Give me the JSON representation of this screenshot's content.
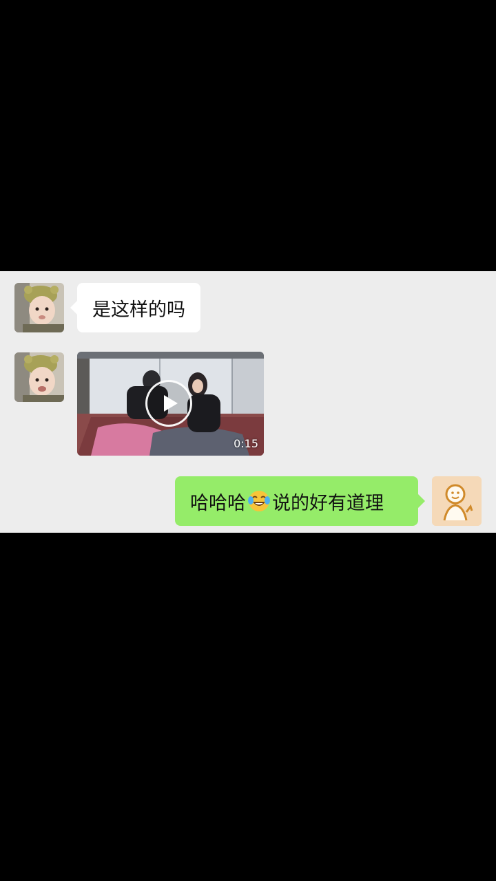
{
  "chat": {
    "messages": [
      {
        "side": "left",
        "type": "text",
        "text": "是这样的吗"
      },
      {
        "side": "left",
        "type": "video",
        "duration": "0:15"
      },
      {
        "side": "right",
        "type": "text",
        "text_before": "哈哈哈",
        "emoji": "tears-of-joy-emoji",
        "text_after": "说的好有道理"
      }
    ]
  },
  "colors": {
    "background": "#000000",
    "chat_background": "#ededed",
    "bubble_received": "#ffffff",
    "bubble_sent": "#95ec69",
    "text": "#111111"
  }
}
